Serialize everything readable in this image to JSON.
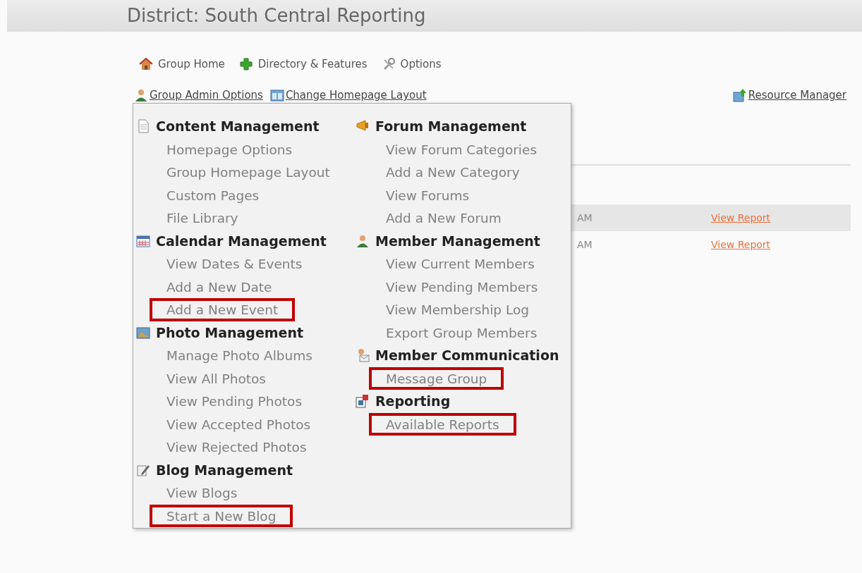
{
  "page_title": "District: South Central Reporting",
  "nav": [
    {
      "label": "Group Home",
      "kind": "house"
    },
    {
      "label": "Directory & Features",
      "kind": "plus"
    },
    {
      "label": "Options",
      "kind": "tools"
    }
  ],
  "admin_links": [
    {
      "label": "Group Admin Options",
      "kind": "person"
    },
    {
      "label": "Change Homepage Layout",
      "kind": "layout"
    }
  ],
  "resource_link": {
    "label": "Resource Manager"
  },
  "table": {
    "rows": [
      {
        "column_1": "AM",
        "link": "View Report",
        "shaded": true
      },
      {
        "column_1": "AM",
        "link": "View Report",
        "shaded": false
      }
    ]
  },
  "admin_menu": {
    "columns": [
      [
        {
          "title": "Content Management",
          "kind": "page",
          "items": [
            {
              "label": "Homepage Options",
              "highlighted": false
            },
            {
              "label": "Group Homepage Layout",
              "highlighted": false
            },
            {
              "label": "Custom Pages",
              "highlighted": false
            },
            {
              "label": "File Library",
              "highlighted": false
            }
          ]
        },
        {
          "title": "Calendar Management",
          "kind": "calendar",
          "items": [
            {
              "label": "View Dates & Events",
              "highlighted": false
            },
            {
              "label": "Add a New Date",
              "highlighted": false
            },
            {
              "label": "Add a New Event",
              "highlighted": true
            }
          ]
        },
        {
          "title": "Photo Management",
          "kind": "photo",
          "items": [
            {
              "label": "Manage Photo Albums",
              "highlighted": false
            },
            {
              "label": "View All Photos",
              "highlighted": false
            },
            {
              "label": "View Pending Photos",
              "highlighted": false
            },
            {
              "label": "View Accepted Photos",
              "highlighted": false
            },
            {
              "label": "View Rejected Photos",
              "highlighted": false
            }
          ]
        },
        {
          "title": "Blog Management",
          "kind": "pencil",
          "items": [
            {
              "label": "View Blogs",
              "highlighted": false
            },
            {
              "label": "Start a New Blog",
              "highlighted": true
            }
          ]
        }
      ],
      [
        {
          "title": "Forum Management",
          "kind": "megaphone",
          "items": [
            {
              "label": "View Forum Categories",
              "highlighted": false
            },
            {
              "label": "Add a New Category",
              "highlighted": false
            },
            {
              "label": "View Forums",
              "highlighted": false
            },
            {
              "label": "Add a New Forum",
              "highlighted": false
            }
          ]
        },
        {
          "title": "Member Management",
          "kind": "person",
          "items": [
            {
              "label": "View Current Members",
              "highlighted": false
            },
            {
              "label": "View Pending Members",
              "highlighted": false
            },
            {
              "label": "View Membership Log",
              "highlighted": false
            },
            {
              "label": "Export Group Members",
              "highlighted": false
            }
          ]
        },
        {
          "title": "Member Communication",
          "kind": "mail",
          "items": [
            {
              "label": "Message Group",
              "highlighted": true
            }
          ]
        },
        {
          "title": "Reporting",
          "kind": "report",
          "items": [
            {
              "label": "Available Reports",
              "highlighted": true
            }
          ]
        }
      ]
    ]
  }
}
